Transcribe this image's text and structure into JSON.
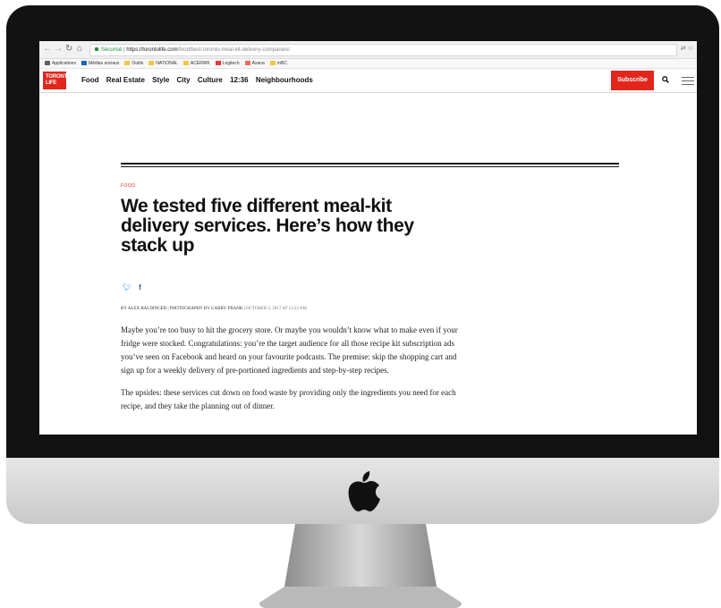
{
  "browser": {
    "security_label": "Sécurisé",
    "url_host": "https://torontolife.com",
    "url_path": "/food/best-toronto-meal-kit-delivery-companies/"
  },
  "bookmarks": [
    {
      "label": "Applications",
      "color": "#5f6368"
    },
    {
      "label": "Médias sociaux",
      "color": "#1565c0"
    },
    {
      "label": "Outils",
      "color": "#f4c542"
    },
    {
      "label": "NATIONAL",
      "color": "#f4c542"
    },
    {
      "label": "ACERWK",
      "color": "#f4c542"
    },
    {
      "label": "Logitech",
      "color": "#e53935"
    },
    {
      "label": "Asana",
      "color": "#ef6c57"
    },
    {
      "label": "mBC",
      "color": "#f4c542"
    }
  ],
  "site": {
    "logo_line1": "TORONTO",
    "logo_line2": "LIFE",
    "nav": [
      "Food",
      "Real Estate",
      "Style",
      "City",
      "Culture",
      "12:36",
      "Neighbourhoods"
    ],
    "subscribe_label": "Subscribe"
  },
  "article": {
    "kicker": "FOOD",
    "headline": "We tested five different meal-kit delivery services. Here’s how they stack up",
    "byline": "BY ALEX BALDINGER | PHOTOGRAPHY BY GABBY FRANK |",
    "date": "OCTOBER 2, 2017 AT 11:33 AM",
    "paragraphs": [
      "Maybe you’re too busy to hit the grocery store. Or maybe you wouldn’t know what to make even if your fridge were stocked. Congratulations: you’re the target audience for all those recipe kit subscription ads you’ve seen on Facebook and heard on your favourite podcasts. The premise: skip the shopping cart and sign up for a weekly delivery of pre-portioned ingredients and step-by-step recipes.",
      "The upsides: these services cut down on food waste by providing only the ingredients you need for each recipe, and they take the planning out of dinner."
    ]
  },
  "colors": {
    "brand_red": "#e2261c",
    "bezel": "#121212",
    "twitter": "#1da1f2",
    "facebook": "#3b5998"
  },
  "icons": [
    "back-icon",
    "forward-icon",
    "reload-icon",
    "home-icon",
    "lock-icon",
    "translate-icon",
    "star-icon",
    "twitter-icon",
    "facebook-icon",
    "search-icon",
    "hamburger-menu-icon",
    "apple-logo-icon"
  ]
}
